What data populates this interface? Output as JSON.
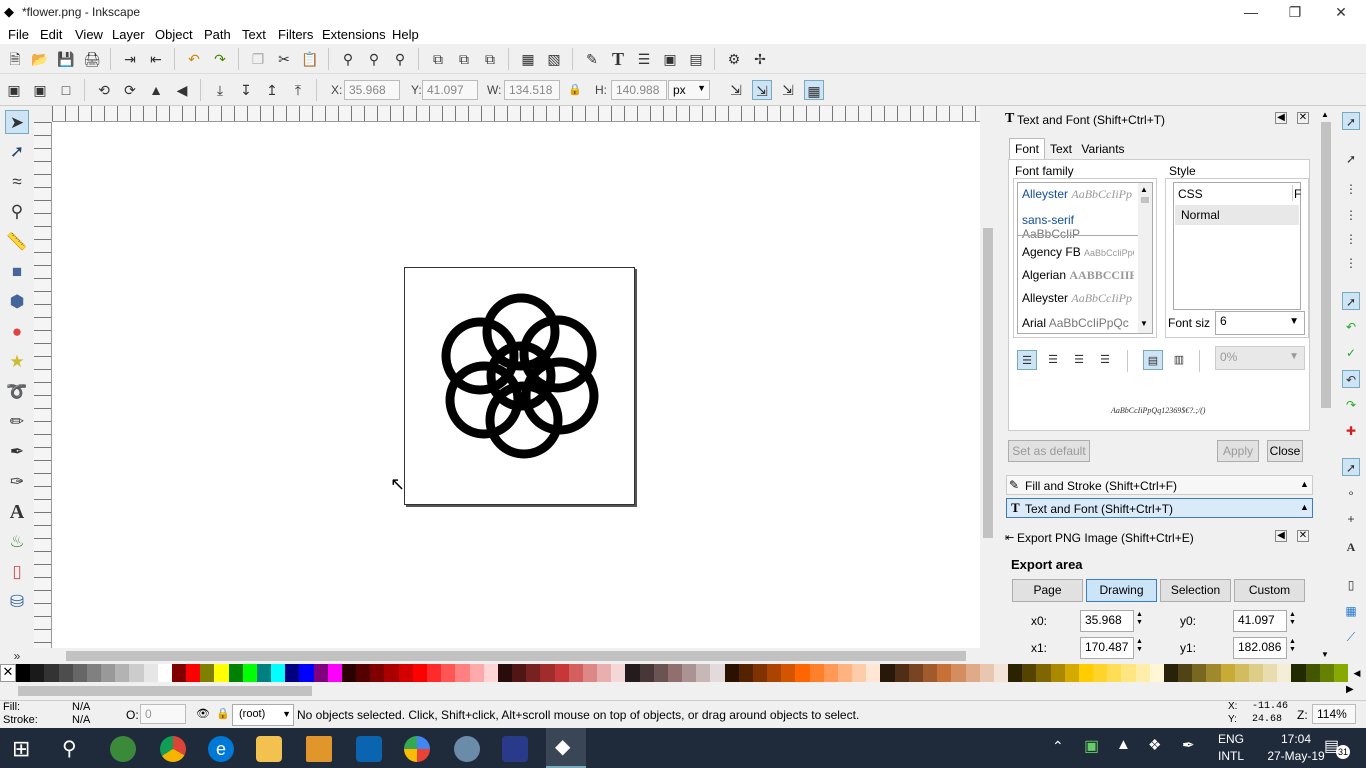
{
  "window": {
    "title": "*flower.png - Inkscape",
    "minimize": "—",
    "restore": "❐",
    "close": "✕"
  },
  "menu": [
    "File",
    "Edit",
    "View",
    "Layer",
    "Object",
    "Path",
    "Text",
    "Filters",
    "Extensions",
    "Help"
  ],
  "controls": {
    "x_label": "X:",
    "x_value": "35.968",
    "y_label": "Y:",
    "y_value": "41.097",
    "w_label": "W:",
    "w_value": "134.518",
    "h_label": "H:",
    "h_value": "140.988",
    "unit": "px"
  },
  "text_font_panel": {
    "title": "Text and Font (Shift+Ctrl+T)",
    "tabs": [
      "Font",
      "Text",
      "Variants"
    ],
    "font_family_label": "Font family",
    "style_label": "Style",
    "fonts_top": [
      {
        "name": "Alleyster",
        "sample": "AaBbCcIiPp"
      },
      {
        "name": "sans-serif",
        "sample": "AaBbCcIiP"
      }
    ],
    "fonts_list": [
      {
        "name": "Agency FB",
        "sample": "AaBbCcIiPpQ"
      },
      {
        "name": "Algerian",
        "sample": "AABBCCIIF"
      },
      {
        "name": "Alleyster",
        "sample": "AaBbCcIiPp"
      },
      {
        "name": "Arial",
        "sample": "AaBbCcIiPpQc"
      }
    ],
    "style_css_header": "CSS",
    "style_f_header": "F",
    "style_value": "Normal",
    "font_size_label": "Font siz",
    "font_size_value": "6",
    "spacing_value": "0%",
    "preview_text": "AaBbCcIiPpQq12369$€?.;/()",
    "set_default": "Set as default",
    "apply": "Apply",
    "close": "Close"
  },
  "fill_stroke_header": "Fill and Stroke (Shift+Ctrl+F)",
  "text_font_header": "Text and Font (Shift+Ctrl+T)",
  "export_panel": {
    "title": "Export PNG Image (Shift+Ctrl+E)",
    "export_area_label": "Export area",
    "area_buttons": [
      "Page",
      "Drawing",
      "Selection",
      "Custom"
    ],
    "x0_label": "x0:",
    "x0_value": "35.968",
    "y0_label": "y0:",
    "y0_value": "41.097",
    "x1_label": "x1:",
    "x1_value": "170.487",
    "y1_label": "y1:",
    "y1_value": "182.086"
  },
  "status": {
    "fill_label": "Fill:",
    "fill_value": "N/A",
    "stroke_label": "Stroke:",
    "stroke_value": "N/A",
    "opacity_label": "O:",
    "opacity_value": "0",
    "layer_value": "(root)",
    "message": "No objects selected. Click, Shift+click, Alt+scroll mouse on top of objects, or drag around objects to select.",
    "cursor_x_label": "X:",
    "cursor_x": "-11.46",
    "cursor_y_label": "Y:",
    "cursor_y": "24.68",
    "zoom_label": "Z:",
    "zoom_value": "114%"
  },
  "taskbar": {
    "lang_top": "ENG",
    "lang_bottom": "INTL",
    "time": "17:04",
    "date": "27-May-19",
    "notification_count": "31"
  },
  "palette": [
    "#000000",
    "#1a1a1a",
    "#333333",
    "#4d4d4d",
    "#666666",
    "#808080",
    "#999999",
    "#b3b3b3",
    "#cccccc",
    "#e6e6e6",
    "#ffffff",
    "#800000",
    "#ff0000",
    "#808000",
    "#ffff00",
    "#008000",
    "#00ff00",
    "#008080",
    "#00ffff",
    "#000080",
    "#0000ff",
    "#800080",
    "#ff00ff",
    "#2b0000",
    "#550000",
    "#800000",
    "#aa0000",
    "#d40000",
    "#ff0000",
    "#ff2a2a",
    "#ff5555",
    "#ff8080",
    "#ffaaaa",
    "#ffd5d5",
    "#280b0b",
    "#501616",
    "#782121",
    "#a02c2c",
    "#c83737",
    "#d35f5f",
    "#de8787",
    "#e9afaf",
    "#f4d7d7",
    "#241c1c",
    "#483737",
    "#6c5353",
    "#916f6f",
    "#ac9393",
    "#c8b7b7",
    "#e3dbdb",
    "#2b1100",
    "#552200",
    "#803300",
    "#aa4400",
    "#d45500",
    "#ff6600",
    "#ff7f2a",
    "#ff9955",
    "#ffb380",
    "#ffccaa",
    "#ffe6d5",
    "#28170b",
    "#502d16",
    "#784421",
    "#a05a2c",
    "#c87137",
    "#d38d5f",
    "#deaa87",
    "#e9c6af",
    "#f4e3d7",
    "#2b2200",
    "#554400",
    "#806600",
    "#aa8800",
    "#d4aa00",
    "#ffcc00",
    "#ffd42a",
    "#ffdd55",
    "#ffe680",
    "#ffeeaa",
    "#fff6d5",
    "#28220b",
    "#504416",
    "#786721",
    "#a0892c",
    "#c8ab37",
    "#d3bc5f",
    "#decd87",
    "#e9ddaf",
    "#f4eed7",
    "#222b00",
    "#445500",
    "#668000",
    "#88aa00"
  ]
}
